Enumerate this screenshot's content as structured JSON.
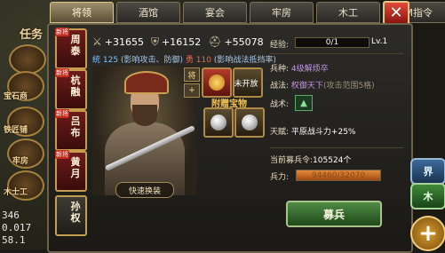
{
  "hud_left": {
    "top_label": "任务",
    "buttons": [
      "宝石商",
      "铁匠铺",
      "牢房",
      "木士工"
    ],
    "numbers": [
      "346",
      "0.017",
      "58.1"
    ]
  },
  "tabs": [
    "将领",
    "酒馆",
    "宴会",
    "牢房",
    "木工",
    "GM指令"
  ],
  "close_label": "✕",
  "generals": [
    {
      "name": "周泰",
      "badge": "新将"
    },
    {
      "name": "杭融",
      "badge": "新将"
    },
    {
      "name": "吕布",
      "badge": "新将"
    },
    {
      "name": "黄月",
      "badge": "新将"
    },
    {
      "name": "孙权",
      "badge": ""
    }
  ],
  "stats": {
    "attack": "+31655",
    "defense": "+16152",
    "troops": "+55078"
  },
  "subinfo": {
    "lead_label": "统",
    "lead_value": "125",
    "lead_note": "(影响攻击、防御)",
    "brave_label": "勇",
    "brave_value": "110",
    "brave_note": "(影响战法抵挡率)"
  },
  "mini_icons": [
    "将",
    "+"
  ],
  "treasures": {
    "label": "附赠宝物",
    "not_open": "未开放"
  },
  "quick_swap": "快速换装",
  "info": {
    "exp_label": "经验:",
    "exp_value": "0/1",
    "level": "Lv.1",
    "soldier_label": "兵种:",
    "soldier_value": "4级解烦卒",
    "skill_label": "战法:",
    "skill_value": "权御天下",
    "skill_note": "(攻击范围5格)",
    "tactic_label": "战术:",
    "tactic_icon": "▲",
    "talent_label": "天赋:",
    "talent_value": "平原战斗力+25%",
    "current_troops_label": "当前募兵令:",
    "current_troops_value": "105524个",
    "troop_label": "兵力:",
    "troop_value": "94460/32070"
  },
  "recruit": "募兵",
  "hud_right": [
    "界",
    "木"
  ],
  "plus": "+"
}
